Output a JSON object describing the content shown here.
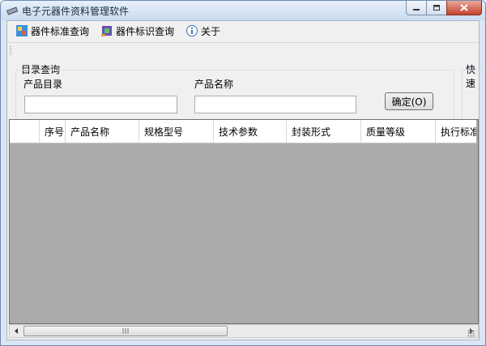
{
  "window": {
    "title": "电子元器件资料管理软件"
  },
  "menu": [
    {
      "label": "器件标准查询",
      "icon": "database-icon"
    },
    {
      "label": "器件标识查询",
      "icon": "chip-icon"
    },
    {
      "label": "关于",
      "icon": "info-icon"
    }
  ],
  "search": {
    "group_label": "目录查询",
    "quick_label": "快速",
    "catalog_label": "产品目录",
    "catalog_value": "",
    "name_label": "产品名称",
    "name_value": "",
    "confirm_label": "确定(O)"
  },
  "grid": {
    "columns": [
      "序号",
      "产品名称",
      "规格型号",
      "技术参数",
      "封装形式",
      "质量等级",
      "执行标准"
    ],
    "rows": []
  },
  "colors": {
    "grid_background": "#ababab",
    "window_frame": "#dbe6f3"
  }
}
